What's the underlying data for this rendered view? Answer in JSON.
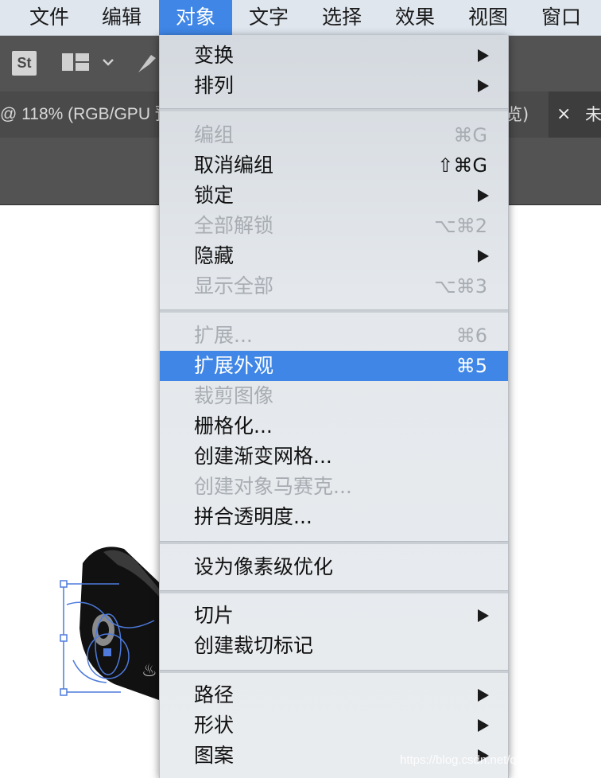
{
  "menubar": {
    "items": [
      "文件",
      "编辑",
      "对象",
      "文字",
      "选择",
      "效果",
      "视图",
      "窗口"
    ],
    "active": "对象"
  },
  "controlbar": {
    "stock_logo": "St"
  },
  "tabs": {
    "active_left": "@ 118% (RGB/GPU 预",
    "active_right": "览)",
    "close": "×",
    "next": "未"
  },
  "menu": {
    "transform": "变换",
    "arrange": "排列",
    "group": "编组",
    "group_sc": "⌘G",
    "ungroup": "取消编组",
    "ungroup_sc": "⇧⌘G",
    "lock": "锁定",
    "unlock_all": "全部解锁",
    "unlock_all_sc": "⌥⌘2",
    "hide": "隐藏",
    "show_all": "显示全部",
    "show_all_sc": "⌥⌘3",
    "expand": "扩展...",
    "expand_sc": "⌘6",
    "expand_appearance": "扩展外观",
    "expand_appearance_sc": "⌘5",
    "crop_image": "裁剪图像",
    "rasterize": "栅格化...",
    "gradient_mesh": "创建渐变网格...",
    "object_mosaic": "创建对象马赛克...",
    "flatten_transparency": "拼合透明度...",
    "pixel_perfect": "设为像素级优化",
    "slice": "切片",
    "trim_marks": "创建裁切标记",
    "path": "路径",
    "shape": "形状",
    "pattern": "图案"
  },
  "watermark": "https://blog.csdn.net/qq_41717874",
  "colors": {
    "highlight": "#3f86e6",
    "menubar": "#dfe6ee",
    "panel": "#535353",
    "disabled_text": "#a8adb3"
  }
}
